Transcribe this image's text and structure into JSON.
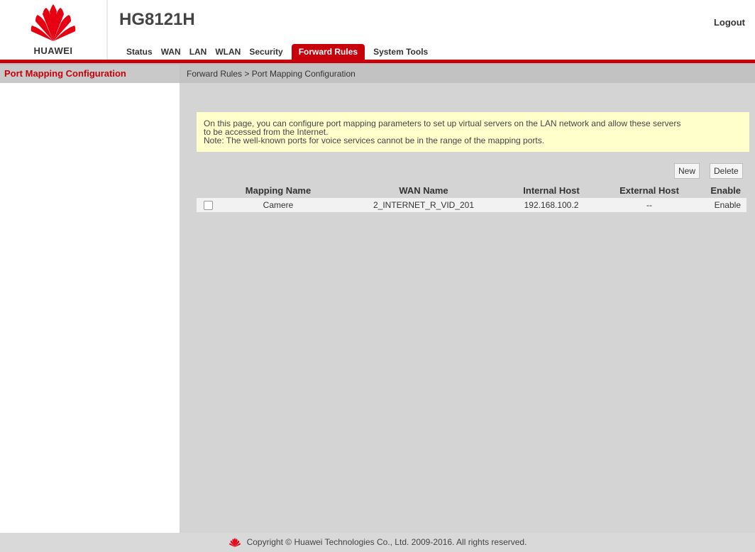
{
  "header": {
    "brand": "HUAWEI",
    "model": "HG8121H",
    "logout": "Logout"
  },
  "nav": {
    "tabs": [
      {
        "label": "Status"
      },
      {
        "label": "WAN"
      },
      {
        "label": "LAN"
      },
      {
        "label": "WLAN"
      },
      {
        "label": "Security"
      },
      {
        "label": "Forward Rules",
        "active": true
      },
      {
        "label": "System Tools"
      }
    ]
  },
  "left_menu": {
    "items": [
      {
        "label": "Port Mapping Configuration",
        "active": true
      }
    ]
  },
  "main": {
    "breadcrumb": "Forward Rules > Port Mapping Configuration",
    "notice": {
      "line1": "On this page, you can configure port mapping parameters to set up virtual servers on the LAN network and allow these servers",
      "line2": "to be accessed from the Internet.",
      "line3": "Note: The well-known ports for voice services cannot be in the range of the mapping ports."
    },
    "buttons": {
      "new": "New",
      "delete": "Delete"
    },
    "table": {
      "headers": [
        "Mapping Name",
        "WAN Name",
        "Internal Host",
        "External Host",
        "Enable"
      ],
      "rows": [
        {
          "mapping_name": "Camere",
          "wan_name": "2_INTERNET_R_VID_201",
          "internal_host": "192.168.100.2",
          "external_host": "--",
          "enable": "Enable",
          "checked": false
        }
      ]
    }
  },
  "footer": {
    "copyright": "Copyright © Huawei Technologies Co., Ltd. 2009-2016. All rights reserved."
  },
  "colors": {
    "accent": "#c7000b",
    "notice_bg": "#ffffcc",
    "content_bg": "#d4d4d4"
  }
}
